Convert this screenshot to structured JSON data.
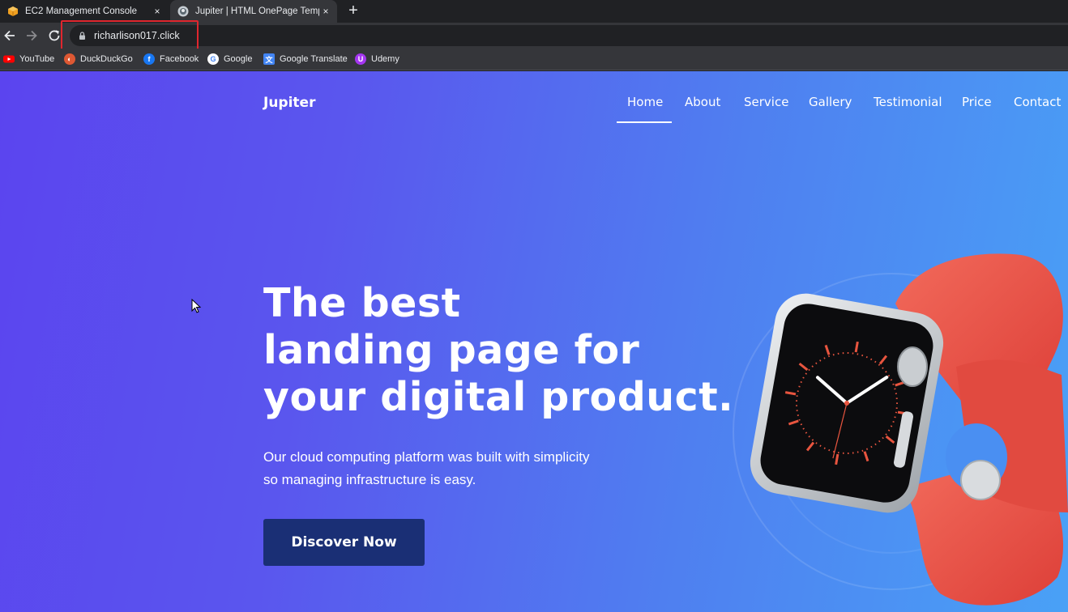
{
  "browser": {
    "tabs": [
      {
        "title": "EC2 Management Console",
        "close": "×",
        "active": false
      },
      {
        "title": "Jupiter | HTML OnePage Template",
        "close": "×",
        "active": true
      }
    ],
    "new_tab": "+",
    "url": "richarlison017.click",
    "bookmarks": [
      "YouTube",
      "DuckDuckGo",
      "Facebook",
      "Google",
      "Google Translate",
      "Udemy"
    ]
  },
  "site": {
    "brand": "Jupiter",
    "nav": [
      "Home",
      "About",
      "Service",
      "Gallery",
      "Testimonial",
      "Price",
      "Contact"
    ],
    "active_nav": "Home",
    "hero_title_lines": [
      "The best",
      "landing page for",
      "your digital product."
    ],
    "hero_subtitle_lines": [
      "Our cloud computing platform was built with simplicity",
      "so managing infrastructure is easy."
    ],
    "cta_label": "Discover Now"
  },
  "colors": {
    "gradient_start": "#5b44ef",
    "gradient_end": "#49a1f6",
    "cta_bg": "#1a2f75",
    "highlight_box": "#e0262e",
    "watch_band": "#ec5247"
  },
  "icons": [
    "aws-favicon",
    "jupiter-favicon",
    "back-icon",
    "forward-icon",
    "reload-icon",
    "lock-icon",
    "youtube-icon",
    "duckduckgo-icon",
    "facebook-icon",
    "google-icon",
    "google-translate-icon",
    "udemy-icon",
    "mouse-cursor-icon"
  ]
}
